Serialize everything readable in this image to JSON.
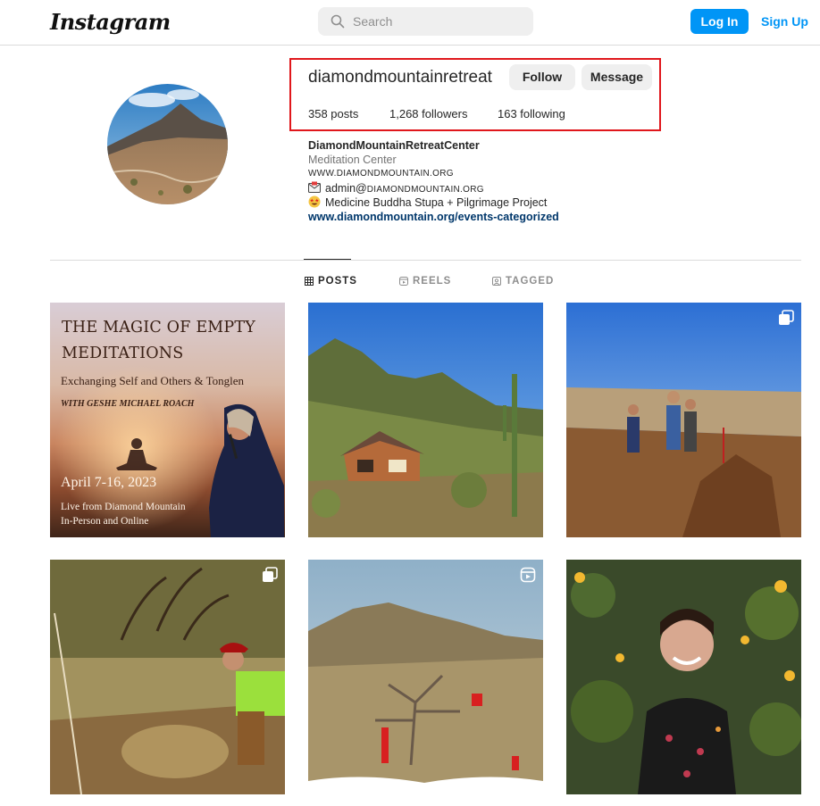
{
  "app": {
    "logo_text": "Instagram"
  },
  "search": {
    "placeholder": "Search"
  },
  "auth": {
    "login_label": "Log In",
    "signup_label": "Sign Up"
  },
  "profile": {
    "username": "diamondmountainretreat",
    "follow_label": "Follow",
    "message_label": "Message",
    "posts": "358 posts",
    "followers": "1,268 followers",
    "following": "163 following",
    "display_name": "DiamondMountainRetreatCenter",
    "category": "Meditation Center",
    "bio_website_upper": "WWW.DIAMONDMOUNTAIN.ORG",
    "bio_email_prefix": "admin@",
    "bio_email_domain": "DIAMONDMOUNTAIN.ORG",
    "bio_project": "Medicine Buddha Stupa + Pilgrimage Project",
    "external_link": "www.diamondmountain.org/events-categorized"
  },
  "tabs": [
    {
      "label": "POSTS",
      "icon": "grid-icon",
      "active": true
    },
    {
      "label": "REELS",
      "icon": "reels-icon",
      "active": false
    },
    {
      "label": "TAGGED",
      "icon": "tagged-icon",
      "active": false
    }
  ],
  "posts_grid": [
    {
      "kind": "poster",
      "title_line1": "THE MAGIC OF EMPTY",
      "title_line2": "MEDITATIONS",
      "subtitle": "Exchanging Self and Others & Tonglen",
      "with": "WITH GESHE MICHAEL ROACH",
      "date": "April 7-16, 2023",
      "live_line1": "Live from Diamond Mountain",
      "live_line2": "In-Person and Online"
    },
    {
      "kind": "photo",
      "subject": "cabin in desert mountains"
    },
    {
      "kind": "photo",
      "subject": "three people on dirt mound",
      "badge": "carousel-icon"
    },
    {
      "kind": "photo",
      "subject": "woman in desert brush",
      "badge": "carousel-icon"
    },
    {
      "kind": "photo",
      "subject": "hill with red flags",
      "badge": "reel-icon"
    },
    {
      "kind": "photo",
      "subject": "smiling woman with sunflowers"
    }
  ],
  "colors": {
    "accent": "#0095f6",
    "highlight_box": "#e0171c",
    "link": "#00376b"
  }
}
